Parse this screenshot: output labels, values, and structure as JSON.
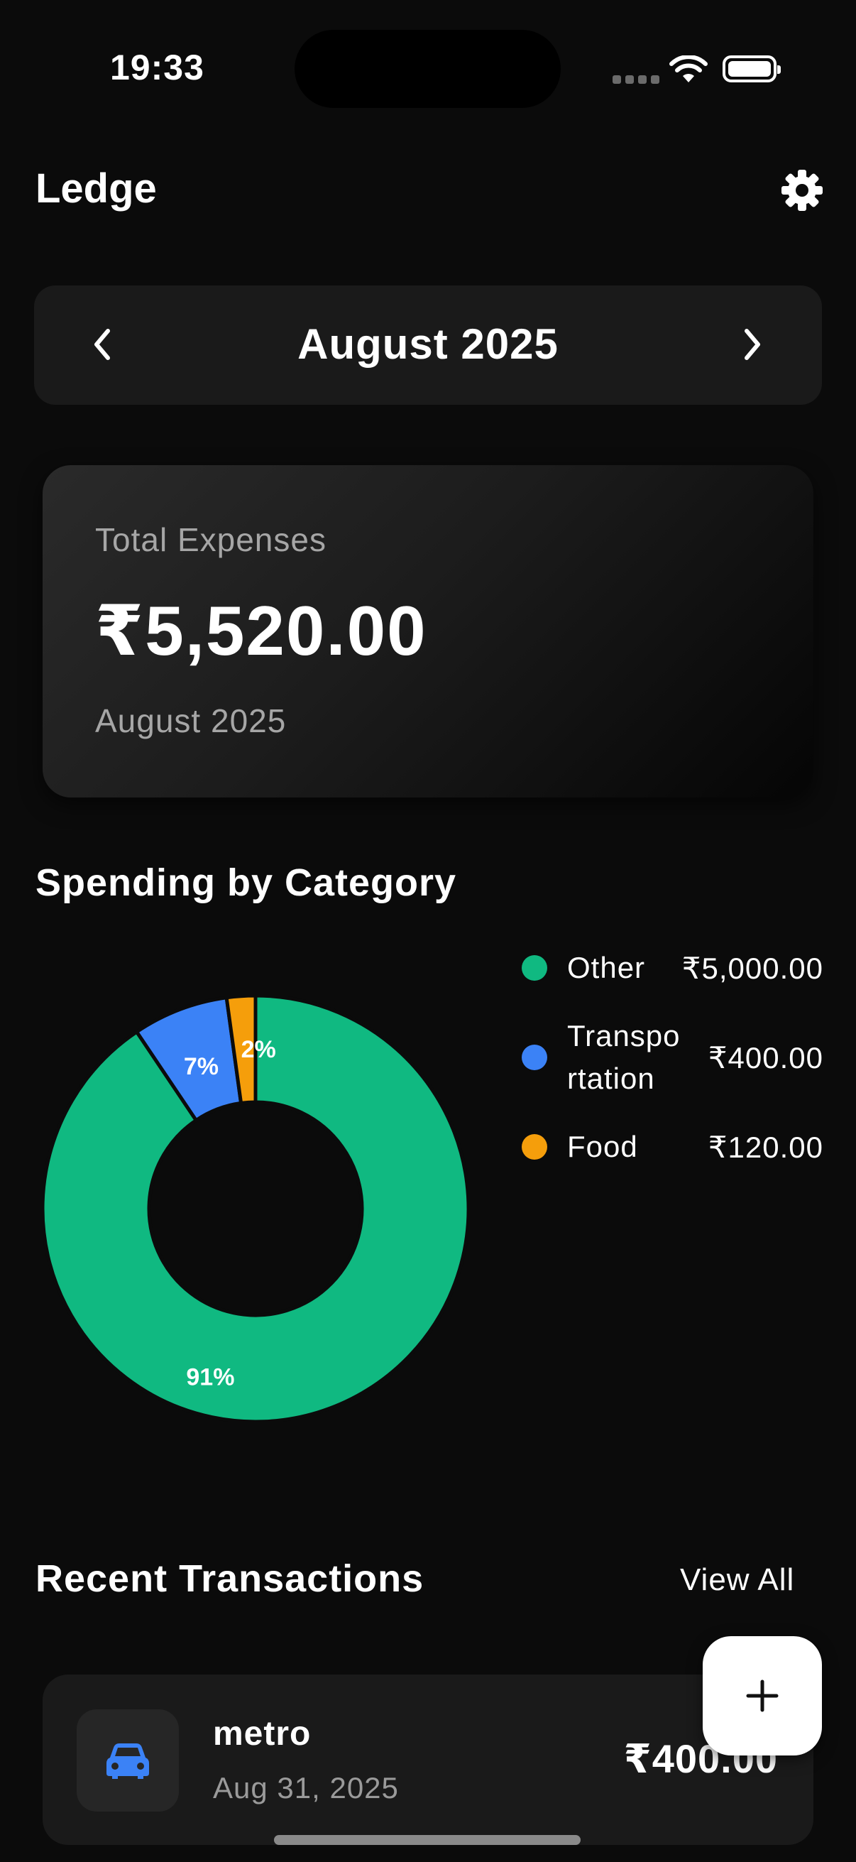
{
  "status_bar": {
    "time": "19:33"
  },
  "header": {
    "title": "Ledge",
    "settings_icon": "gear-icon"
  },
  "month_selector": {
    "label": "August 2025",
    "prev_icon": "chevron-left-icon",
    "next_icon": "chevron-right-icon"
  },
  "summary": {
    "label": "Total Expenses",
    "amount": "₹5,520.00",
    "period": "August 2025"
  },
  "spending": {
    "title": "Spending by Category",
    "legend": [
      {
        "name": "Other",
        "amount": "₹5,000.00",
        "color": "#10b981"
      },
      {
        "name": "Transpo\nrtation",
        "amount": "₹400.00",
        "color": "#3b82f6"
      },
      {
        "name": "Food",
        "amount": "₹120.00",
        "color": "#f59e0b"
      }
    ]
  },
  "chart_data": {
    "type": "pie",
    "categories": [
      "Other",
      "Transportation",
      "Food"
    ],
    "values": [
      5000,
      400,
      120
    ],
    "labels": [
      "91%",
      "7%",
      "2%"
    ],
    "colors": [
      "#10b981",
      "#3b82f6",
      "#f59e0b"
    ],
    "title": ""
  },
  "recent": {
    "title": "Recent Transactions",
    "view_all": "View All",
    "transactions": [
      {
        "name": "metro",
        "date": "Aug 31, 2025",
        "amount": "₹400.00",
        "icon": "car-icon"
      }
    ]
  },
  "fab": {
    "icon": "plus-icon"
  }
}
